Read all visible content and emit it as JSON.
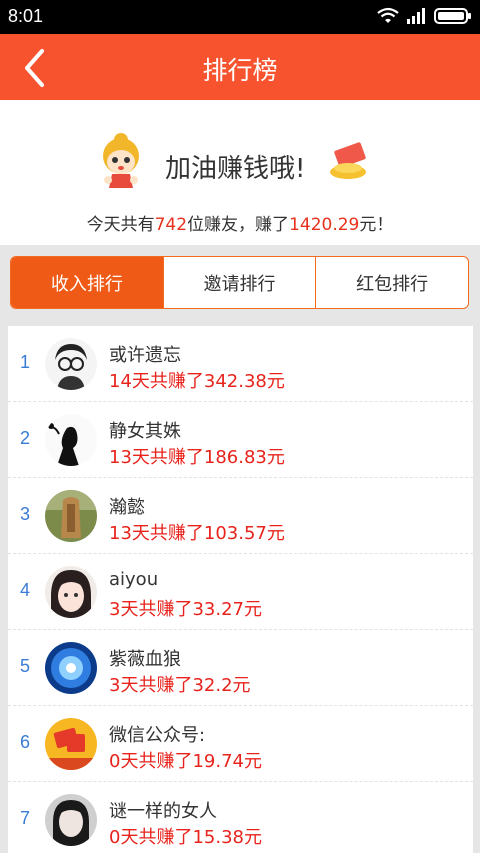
{
  "status_bar": {
    "time": "8:01"
  },
  "nav": {
    "title": "排行榜"
  },
  "header": {
    "cheer": "加油赚钱哦!",
    "summary_prefix": "今天共有",
    "friend_count": "742",
    "summary_middle": "位赚友，赚了",
    "total_amount": "1420.29",
    "summary_suffix": "元！"
  },
  "tabs": [
    {
      "label": "收入排行",
      "active": true
    },
    {
      "label": "邀请排行",
      "active": false
    },
    {
      "label": "红包排行",
      "active": false
    }
  ],
  "rankings": [
    {
      "rank": "1",
      "name": "或许遗忘",
      "earnings": "14天共赚了342.38元"
    },
    {
      "rank": "2",
      "name": "静女其姝",
      "earnings": "13天共赚了186.83元"
    },
    {
      "rank": "3",
      "name": "瀚懿",
      "earnings": "13天共赚了103.57元"
    },
    {
      "rank": "4",
      "name": "aiyou",
      "earnings": "3天共赚了33.27元"
    },
    {
      "rank": "5",
      "name": "紫薇血狼",
      "earnings": "3天共赚了32.2元"
    },
    {
      "rank": "6",
      "name": "微信公众号:",
      "earnings": "0天共赚了19.74元"
    },
    {
      "rank": "7",
      "name": "谜一样的女人",
      "earnings": "0天共赚了15.38元"
    }
  ],
  "colors": {
    "accent": "#f7532f",
    "active_tab": "#ef5a17",
    "highlight": "#e8301c",
    "rank": "#3a7bd5"
  }
}
